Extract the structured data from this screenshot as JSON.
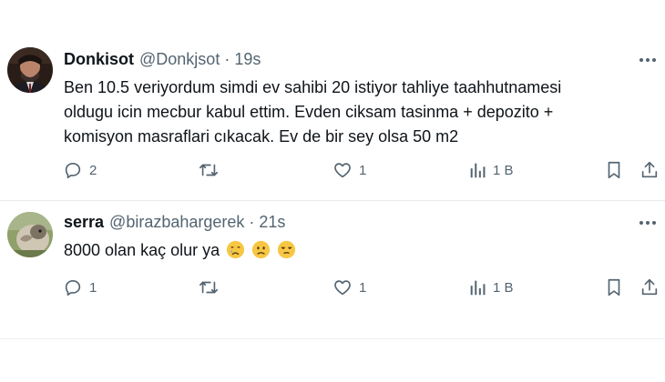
{
  "tweets": [
    {
      "name": "Donkisot",
      "handle": "@Donkjsot",
      "separator": "·",
      "time": "19s",
      "lines": [
        "Ben 10.5 veriyordum simdi ev sahibi 20 istiyor tahliye taahhutnamesi",
        "oldugu icin mecbur kabul ettim. Evden ciksam tasinma + depozito +",
        "komisyon masraflari cıkacak. Ev de bir sey olsa 50 m2"
      ],
      "reply_count": "2",
      "retweet_count": "",
      "like_count": "1",
      "view_count": "1 B"
    },
    {
      "name": "serra",
      "handle": "@birazbahargerek",
      "separator": "·",
      "time": "21s",
      "lines": [
        "8000 olan kaç olur ya"
      ],
      "emojis": [
        "crying-face",
        "slightly-frowning-face",
        "unamused-face"
      ],
      "reply_count": "1",
      "retweet_count": "",
      "like_count": "1",
      "view_count": "1 B"
    }
  ],
  "colors": {
    "text": "#0f1419",
    "muted": "#536471",
    "divider": "#e7e9ea",
    "emoji": "#f7c744"
  }
}
